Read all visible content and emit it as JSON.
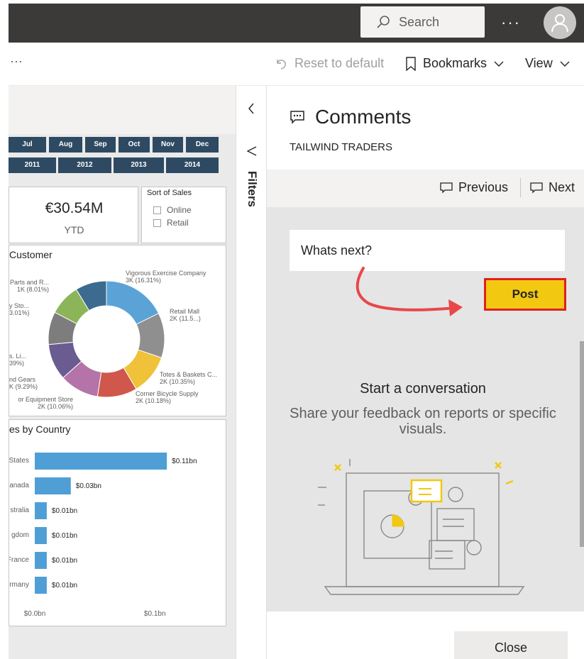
{
  "topbar": {
    "search_placeholder": "Search",
    "more": "···"
  },
  "actionbar": {
    "overflow": "···",
    "reset_label": "Reset to default",
    "bookmarks_label": "Bookmarks",
    "view_label": "View"
  },
  "report": {
    "months": [
      "Jul",
      "Aug",
      "Sep",
      "Oct",
      "Nov",
      "Dec"
    ],
    "years": [
      "2011",
      "2012",
      "2013",
      "2014"
    ],
    "kpi": {
      "value": "€30.54M",
      "label": "YTD"
    },
    "slicer": {
      "title": "Sort of Sales",
      "options": [
        "Online",
        "Retail"
      ]
    },
    "donut": {
      "title": "Customer",
      "labels": [
        {
          "name": "Vigorous Exercise Company",
          "value": "3K (16.31%)"
        },
        {
          "name": "Retail Mall",
          "value": "2K (11.5...)"
        },
        {
          "name": "Totes & Baskets C...",
          "value": "2K (10.35%)"
        },
        {
          "name": "Corner Bicycle Supply",
          "value": "2K (10.18%)"
        },
        {
          "name": "or Equipment Store",
          "value": "2K (10.06%)"
        },
        {
          "name": "nd Gears",
          "value": "K (9.29%)"
        },
        {
          "name": "s. Li...",
          "value": "39%)"
        },
        {
          "name": "y Sto...",
          "value": "3.01%)"
        },
        {
          "name": "Parts and R...",
          "value": "1K (8.01%)"
        }
      ]
    },
    "bars": {
      "title": "es by Country",
      "axis": [
        "$0.0bn",
        "$0.1bn"
      ]
    }
  },
  "chart_data": [
    {
      "type": "pie",
      "title": "Customer",
      "categories": [
        "Vigorous Exercise Company",
        "Retail Mall",
        "Totes & Baskets C...",
        "Corner Bicycle Supply",
        "or Equipment Store",
        "nd Gears",
        "s. Li...",
        "y Sto...",
        "Parts and R..."
      ],
      "values": [
        16.31,
        11.5,
        10.35,
        10.18,
        10.06,
        9.29,
        8.39,
        8.01,
        8.01
      ],
      "colors": [
        "#5ba3d6",
        "#8f8f8f",
        "#f0c23a",
        "#d0574c",
        "#b473a9",
        "#6a5b91",
        "#7d7d7d",
        "#8cb55a",
        "#3d6a8f",
        "#e8b8c0"
      ]
    },
    {
      "type": "bar",
      "title": "es by Country",
      "categories": [
        "States",
        "anada",
        "stralia",
        "gdom",
        "France",
        "rmany"
      ],
      "values": [
        0.11,
        0.03,
        0.01,
        0.01,
        0.01,
        0.01
      ],
      "value_labels": [
        "$0.11bn",
        "$0.03bn",
        "$0.01bn",
        "$0.01bn",
        "$0.01bn",
        "$0.01bn"
      ],
      "xlim": [
        0,
        0.13
      ],
      "orientation": "horizontal",
      "color": "#4f9fd6"
    }
  ],
  "filters": {
    "label": "Filters"
  },
  "comments": {
    "title": "Comments",
    "subtitle": "TAILWIND TRADERS",
    "previous": "Previous",
    "next": "Next",
    "input_value": "Whats next?",
    "post_label": "Post",
    "start_title": "Start a conversation",
    "start_body": "Share your feedback on reports or specific visuals.",
    "close_label": "Close",
    "accent": "#f2c811",
    "highlight": "#e02020"
  }
}
